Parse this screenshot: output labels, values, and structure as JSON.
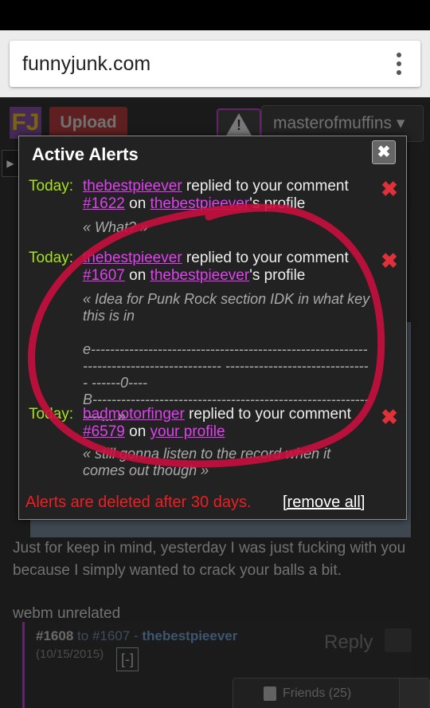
{
  "browser": {
    "url": "funnyjunk.com"
  },
  "site": {
    "logo": "FJ",
    "upload_label": "Upload",
    "username": "masterofmuffins",
    "background_text_1": "Just for keep in mind, yesterday I was just fucking with you because I simply wanted to crack your balls a bit.",
    "background_text_2": "webm unrelated",
    "comment": {
      "id": "#1608",
      "to_word": "to",
      "to_id": "#1607",
      "dash": "-",
      "user": "thebestpieever",
      "date": "(10/15/2015)",
      "reply_label": "Reply",
      "collapse": "[-]"
    },
    "friends_label": "Friends (25)"
  },
  "alerts": {
    "title": "Active Alerts",
    "close_glyph": "✖",
    "items": [
      {
        "day": "Today:",
        "user": "thebestpieever",
        "action": " replied to your comment ",
        "comment_id": "#1622",
        "on": " on ",
        "target": "thebestpieever",
        "target_suffix": "'s profile",
        "quote": "« What? »",
        "delete_glyph": "✖"
      },
      {
        "day": "Today:",
        "user": "thebestpieever",
        "action": " replied to your comment ",
        "comment_id": "#1607",
        "on": " on ",
        "target": "thebestpieever",
        "target_suffix": "'s profile",
        "quote": "« Idea for Punk Rock section IDK in what key this is in\n\ne--------------------------------------------------------------------------------------- ------------------------------- ------0----\nB--------------------------------------------------------------... »",
        "delete_glyph": "✖"
      },
      {
        "day": "Today:",
        "user": "badmotorfinger",
        "action": " replied to your comment ",
        "comment_id": "#6579",
        "on": " on ",
        "target": "your profile",
        "target_suffix": "",
        "quote": "« still gonna listen to the record when it comes out though »",
        "delete_glyph": "✖"
      }
    ],
    "footer_note": "Alerts are deleted after 30 days.",
    "remove_all": "[remove all]"
  },
  "colors": {
    "accent_link": "#e040f0",
    "today_green": "#a8e020",
    "warning_red": "#ee1e22",
    "annotation_circle": "#c8103e"
  }
}
